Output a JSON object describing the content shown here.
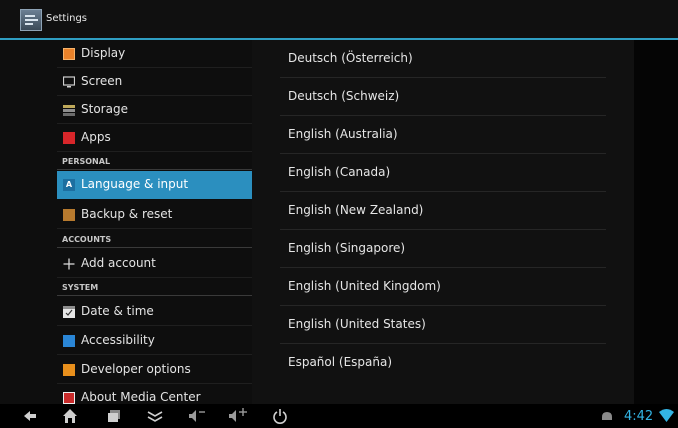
{
  "actionbar": {
    "title": "Settings"
  },
  "leftpane": {
    "items": [
      {
        "label": "Display",
        "icon": "display-icon"
      },
      {
        "label": "Screen",
        "icon": "screen-icon"
      },
      {
        "label": "Storage",
        "icon": "storage-icon"
      },
      {
        "label": "Apps",
        "icon": "apps-icon"
      }
    ],
    "personal_header": "PERSONAL",
    "personal": [
      {
        "label": "Language & input",
        "icon": "language-icon",
        "selected": true
      },
      {
        "label": "Backup & reset",
        "icon": "backup-icon"
      }
    ],
    "accounts_header": "ACCOUNTS",
    "accounts": [
      {
        "label": "Add account",
        "icon": "add-icon"
      }
    ],
    "system_header": "SYSTEM",
    "system": [
      {
        "label": "Date & time",
        "icon": "date-time-icon"
      },
      {
        "label": "Accessibility",
        "icon": "accessibility-icon"
      },
      {
        "label": "Developer options",
        "icon": "developer-icon"
      },
      {
        "label": "About Media Center",
        "icon": "about-icon"
      }
    ]
  },
  "languages": [
    "Deutsch (Österreich)",
    "Deutsch (Schweiz)",
    "English (Australia)",
    "English (Canada)",
    "English (New Zealand)",
    "English (Singapore)",
    "English (United Kingdom)",
    "English (United States)",
    "Español (España)"
  ],
  "navbar": {
    "icons": [
      "back-icon",
      "home-icon",
      "recent-apps-icon",
      "menu-icon",
      "volume-down-icon",
      "volume-up-icon",
      "power-icon",
      "usb-icon",
      "wifi-icon"
    ],
    "clock": "4:42"
  },
  "colors": {
    "accent": "#2b8fbf",
    "clock": "#33b5e5",
    "actionbar_line": "#2f9ec2"
  }
}
